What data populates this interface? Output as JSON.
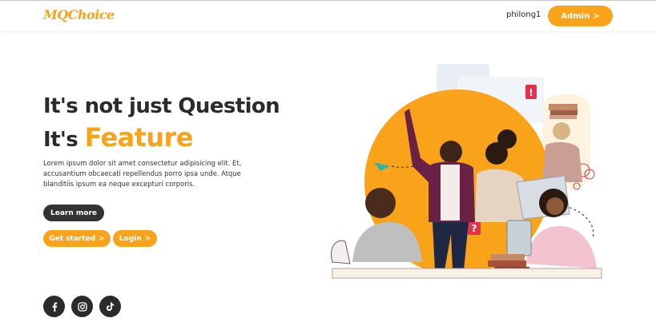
{
  "navbar": {
    "logo": "MQChoice",
    "username": "philong1",
    "admin_label": "Admin",
    "admin_arrow": ">"
  },
  "hero": {
    "headline_line1": "It's not just Question",
    "headline_line2_prefix": "It's",
    "headline_line2_highlight": "Feature",
    "description": "Lorem ipsum dolor sit amet consectetur adipisicing elit. Et, accusantium obcaecati repellendus porro ipsa unde. Atque blanditiis ipsum ea neque excepturi corporis.",
    "learn_more_label": "Learn more",
    "get_started_label": "Get started",
    "login_label": "Login",
    "arrow": ">"
  },
  "social": [
    "facebook-icon",
    "instagram-icon",
    "tiktok-icon"
  ],
  "colors": {
    "accent": "#f9a31a",
    "dark": "#2b2b2b"
  }
}
